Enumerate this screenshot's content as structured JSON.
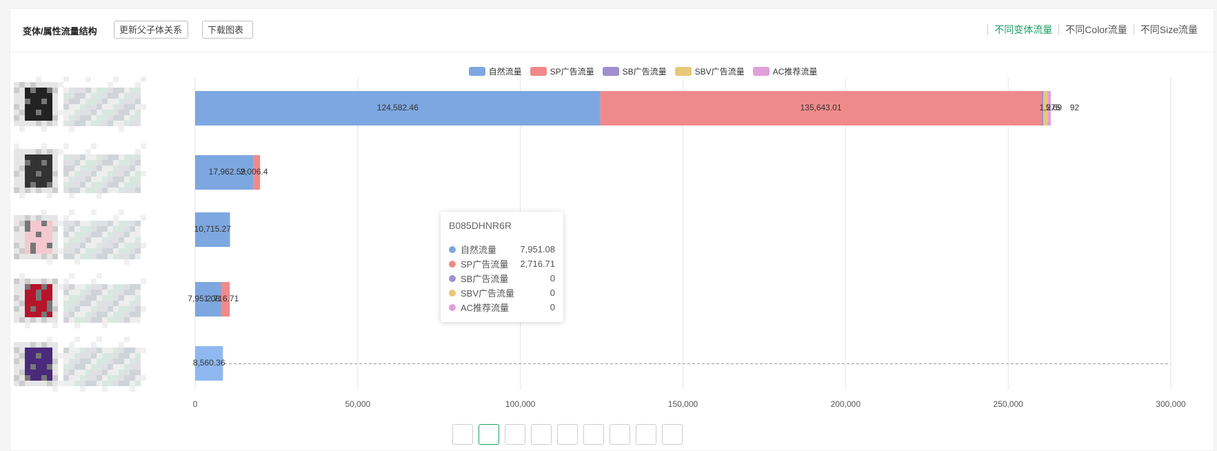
{
  "header": {
    "title": "变体/属性流量结构",
    "update_button": "更新父子体关系",
    "download_button": "下载图表",
    "tabs": [
      {
        "label": "不同变体流量",
        "active": true
      },
      {
        "label": "不同Color流量",
        "active": false
      },
      {
        "label": "不同Size流量",
        "active": false
      }
    ]
  },
  "colors": {
    "natural": "#7da7e0",
    "sp": "#f08a8a",
    "sb": "#a08fd0",
    "sbv": "#e8c87a",
    "ac": "#e0a0d8",
    "accent": "#1aa065"
  },
  "chart_data": {
    "type": "bar",
    "orientation": "horizontal",
    "stacked": true,
    "series": [
      {
        "name": "自然流量",
        "color": "#7da7e0",
        "values": [
          124582.46,
          17962.59,
          10715.27,
          7951.08,
          8560.36
        ]
      },
      {
        "name": "SP广告流量",
        "color": "#f08a8a",
        "values": [
          135643.01,
          2006.4,
          0,
          2716.71,
          0
        ]
      },
      {
        "name": "SB广告流量",
        "color": "#a08fd0",
        "values": [
          600,
          0,
          0,
          0,
          0
        ]
      },
      {
        "name": "SBV广告流量",
        "color": "#e8c87a",
        "values": [
          1275,
          0,
          0,
          0,
          0
        ]
      },
      {
        "name": "AC推荐流量",
        "color": "#e0a0d8",
        "values": [
          992,
          0,
          0,
          0,
          0
        ]
      }
    ],
    "data_labels": [
      [
        "124,582.46",
        "135,643.01",
        "1,275",
        "5.69",
        "92"
      ],
      [
        "17,962.59",
        "2,006.4"
      ],
      [
        "10,715.27"
      ],
      [
        "7,951.08",
        "2,716.71"
      ],
      [
        "8,560.36"
      ]
    ],
    "xlim": [
      0,
      300000
    ],
    "x_ticks": [
      "0",
      "50,000",
      "100,000",
      "150,000",
      "200,000",
      "250,000",
      "300,000"
    ],
    "x_tick_values": [
      0,
      50000,
      100000,
      150000,
      200000,
      250000,
      300000
    ],
    "legend_position": "top-center",
    "grid": true
  },
  "tooltip": {
    "title": "B085DHNR6R",
    "rows": [
      {
        "name": "自然流量",
        "value": "7,951.08",
        "color": "#7da7e0"
      },
      {
        "name": "SP广告流量",
        "value": "2,716.71",
        "color": "#f08a8a"
      },
      {
        "name": "SB广告流量",
        "value": "0",
        "color": "#a08fd0"
      },
      {
        "name": "SBV广告流量",
        "value": "0",
        "color": "#e8c87a"
      },
      {
        "name": "AC推荐流量",
        "value": "0",
        "color": "#e0a0d8"
      }
    ]
  },
  "thumbnails": [
    {
      "icon": "product-thumbnail-icon",
      "tone": "#222222"
    },
    {
      "icon": "product-thumbnail-icon",
      "tone": "#333333"
    },
    {
      "icon": "product-thumbnail-icon",
      "tone": "#f4c8d0"
    },
    {
      "icon": "product-thumbnail-icon",
      "tone": "#b5142a"
    },
    {
      "icon": "product-thumbnail-icon",
      "tone": "#4a2a7a"
    }
  ]
}
